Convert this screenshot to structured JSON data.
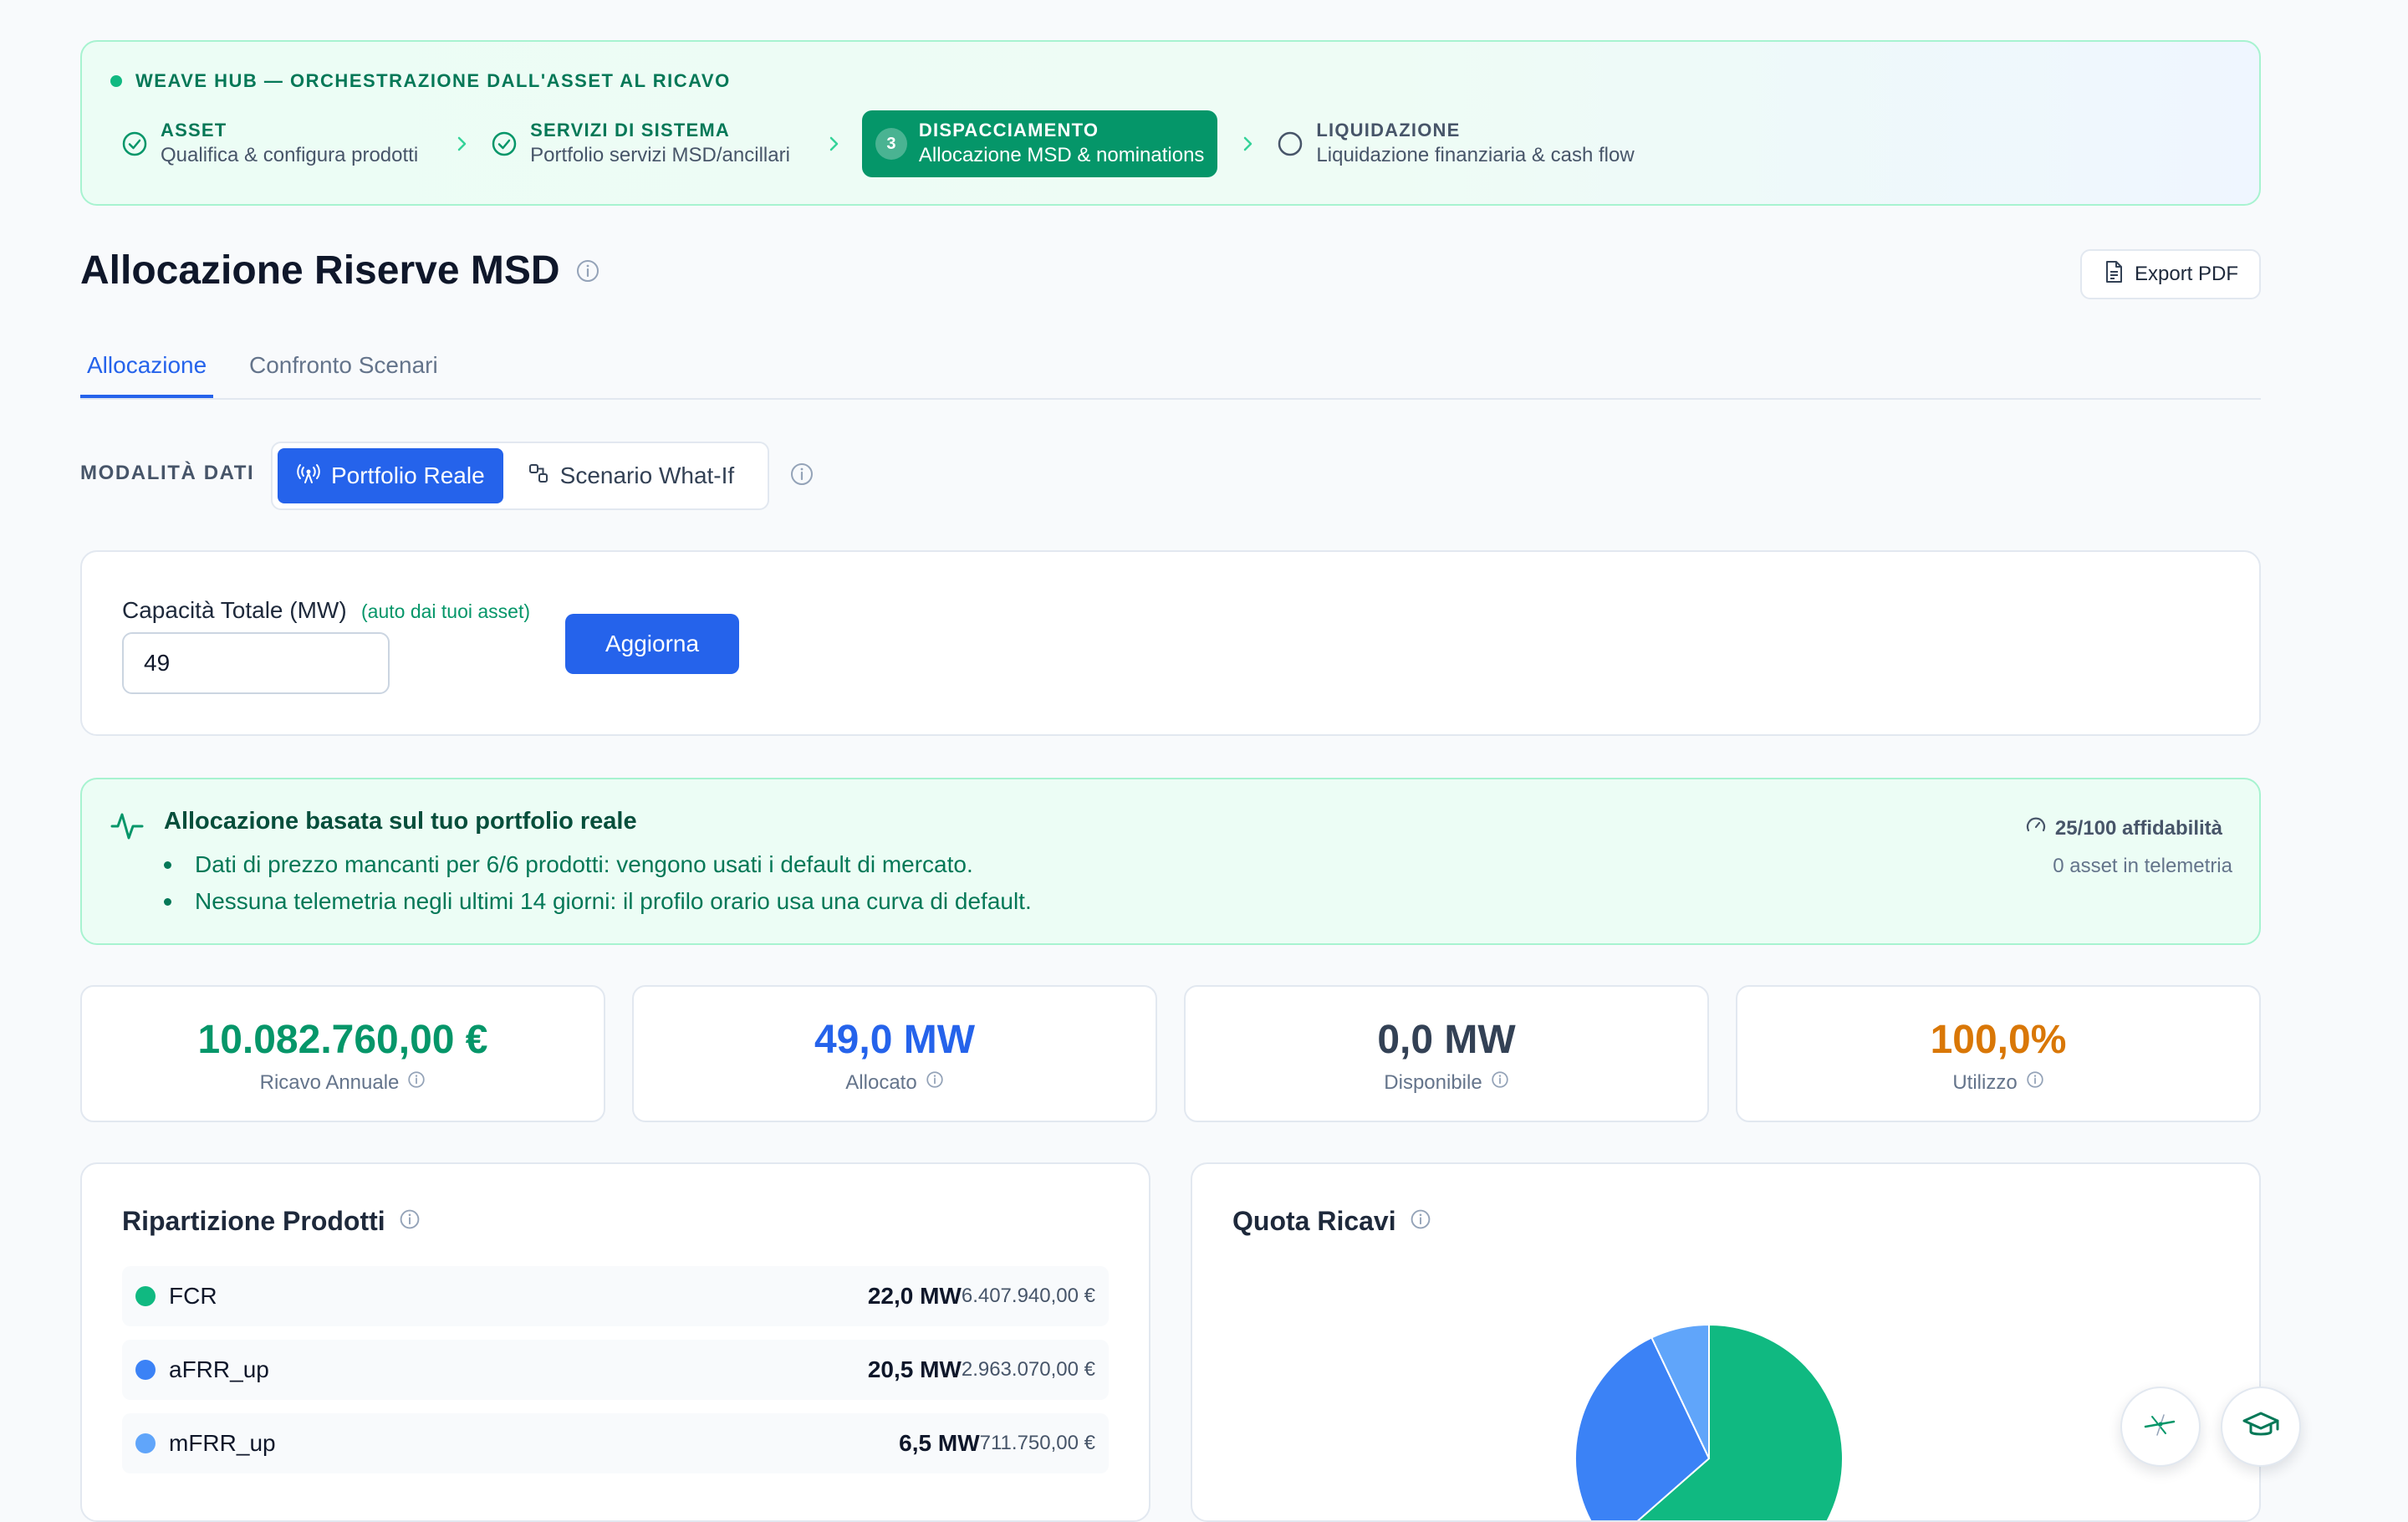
{
  "hub": {
    "title": "WEAVE HUB — ORCHESTRAZIONE DALL'ASSET AL RICAVO",
    "steps": [
      {
        "title": "ASSET",
        "subtitle": "Qualifica & configura prodotti",
        "status": "done"
      },
      {
        "title": "SERVIZI DI SISTEMA",
        "subtitle": "Portfolio servizi MSD/ancillari",
        "status": "done"
      },
      {
        "number": "3",
        "title": "DISPACCIAMENTO",
        "subtitle": "Allocazione MSD & nominations",
        "status": "active"
      },
      {
        "title": "LIQUIDAZIONE",
        "subtitle": "Liquidazione finanziaria & cash flow",
        "status": "pending"
      }
    ]
  },
  "header": {
    "title": "Allocazione Riserve MSD",
    "export_label": "Export PDF"
  },
  "tabs": [
    {
      "label": "Allocazione",
      "active": true
    },
    {
      "label": "Confronto Scenari",
      "active": false
    }
  ],
  "mode": {
    "label": "MODALITÀ DATI",
    "options": [
      {
        "label": "Portfolio Reale",
        "selected": true,
        "icon": "broadcast-icon"
      },
      {
        "label": "Scenario What-If",
        "selected": false,
        "icon": "scenario-icon"
      }
    ]
  },
  "capacity": {
    "label": "Capacità Totale (MW)",
    "hint": "(auto dai tuoi asset)",
    "value": "49",
    "button_label": "Aggiorna"
  },
  "notice": {
    "title": "Allocazione basata sul tuo portfolio reale",
    "items": [
      "Dati di prezzo mancanti per 6/6 prodotti: vengono usati i default di mercato.",
      "Nessuna telemetria negli ultimi 14 giorni: il profilo orario usa una curva di default."
    ],
    "reliability": "25/100 affidabilità",
    "telemetry": "0 asset in telemetria"
  },
  "kpis": [
    {
      "value": "10.082.760,00 €",
      "label": "Ricavo Annuale",
      "color": "#059669"
    },
    {
      "value": "49,0 MW",
      "label": "Allocato",
      "color": "#2563eb"
    },
    {
      "value": "0,0 MW",
      "label": "Disponibile",
      "color": "#334155"
    },
    {
      "value": "100,0%",
      "label": "Utilizzo",
      "color": "#d97706"
    }
  ],
  "breakdown": {
    "title": "Ripartizione Prodotti",
    "products": [
      {
        "name": "FCR",
        "mw": "22,0 MW",
        "revenue": "6.407.940,00 €",
        "color": "#10b981"
      },
      {
        "name": "aFRR_up",
        "mw": "20,5 MW",
        "revenue": "2.963.070,00 €",
        "color": "#3b82f6"
      },
      {
        "name": "mFRR_up",
        "mw": "6,5 MW",
        "revenue": "711.750,00 €",
        "color": "#60a5fa"
      }
    ]
  },
  "revenue_share": {
    "title": "Quota Ricavi"
  },
  "chart_data": {
    "type": "pie",
    "title": "Quota Ricavi",
    "categories": [
      "FCR",
      "aFRR_up",
      "mFRR_up"
    ],
    "values": [
      6407940,
      2963070,
      711750
    ],
    "colors": [
      "#10b981",
      "#3b82f6",
      "#60a5fa"
    ]
  },
  "fabs": [
    {
      "icon": "sparkle-icon"
    },
    {
      "icon": "graduation-cap-icon"
    }
  ]
}
